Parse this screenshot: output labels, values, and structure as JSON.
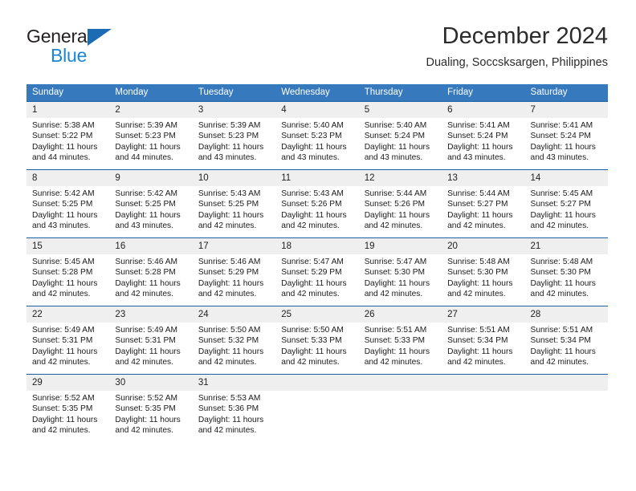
{
  "brand": {
    "name_part1": "General",
    "name_part2": "Blue",
    "triangle_color": "#1b6cb5",
    "blue_text_color": "#1b86d6"
  },
  "header": {
    "title": "December 2024",
    "subtitle": "Dualing, Soccsksargen, Philippines"
  },
  "theme": {
    "header_bg": "#3679bc",
    "row_border": "#1b5fa4",
    "daynum_bg": "#efefef"
  },
  "weekday_headers": [
    "Sunday",
    "Monday",
    "Tuesday",
    "Wednesday",
    "Thursday",
    "Friday",
    "Saturday"
  ],
  "labels": {
    "sunrise_prefix": "Sunrise:",
    "sunset_prefix": "Sunset:",
    "daylight_prefix": "Daylight:"
  },
  "weeks": [
    [
      {
        "day": "1",
        "sunrise": "Sunrise: 5:38 AM",
        "sunset": "Sunset: 5:22 PM",
        "daylight_line1": "Daylight: 11 hours",
        "daylight_line2": "and 44 minutes."
      },
      {
        "day": "2",
        "sunrise": "Sunrise: 5:39 AM",
        "sunset": "Sunset: 5:23 PM",
        "daylight_line1": "Daylight: 11 hours",
        "daylight_line2": "and 44 minutes."
      },
      {
        "day": "3",
        "sunrise": "Sunrise: 5:39 AM",
        "sunset": "Sunset: 5:23 PM",
        "daylight_line1": "Daylight: 11 hours",
        "daylight_line2": "and 43 minutes."
      },
      {
        "day": "4",
        "sunrise": "Sunrise: 5:40 AM",
        "sunset": "Sunset: 5:23 PM",
        "daylight_line1": "Daylight: 11 hours",
        "daylight_line2": "and 43 minutes."
      },
      {
        "day": "5",
        "sunrise": "Sunrise: 5:40 AM",
        "sunset": "Sunset: 5:24 PM",
        "daylight_line1": "Daylight: 11 hours",
        "daylight_line2": "and 43 minutes."
      },
      {
        "day": "6",
        "sunrise": "Sunrise: 5:41 AM",
        "sunset": "Sunset: 5:24 PM",
        "daylight_line1": "Daylight: 11 hours",
        "daylight_line2": "and 43 minutes."
      },
      {
        "day": "7",
        "sunrise": "Sunrise: 5:41 AM",
        "sunset": "Sunset: 5:24 PM",
        "daylight_line1": "Daylight: 11 hours",
        "daylight_line2": "and 43 minutes."
      }
    ],
    [
      {
        "day": "8",
        "sunrise": "Sunrise: 5:42 AM",
        "sunset": "Sunset: 5:25 PM",
        "daylight_line1": "Daylight: 11 hours",
        "daylight_line2": "and 43 minutes."
      },
      {
        "day": "9",
        "sunrise": "Sunrise: 5:42 AM",
        "sunset": "Sunset: 5:25 PM",
        "daylight_line1": "Daylight: 11 hours",
        "daylight_line2": "and 43 minutes."
      },
      {
        "day": "10",
        "sunrise": "Sunrise: 5:43 AM",
        "sunset": "Sunset: 5:25 PM",
        "daylight_line1": "Daylight: 11 hours",
        "daylight_line2": "and 42 minutes."
      },
      {
        "day": "11",
        "sunrise": "Sunrise: 5:43 AM",
        "sunset": "Sunset: 5:26 PM",
        "daylight_line1": "Daylight: 11 hours",
        "daylight_line2": "and 42 minutes."
      },
      {
        "day": "12",
        "sunrise": "Sunrise: 5:44 AM",
        "sunset": "Sunset: 5:26 PM",
        "daylight_line1": "Daylight: 11 hours",
        "daylight_line2": "and 42 minutes."
      },
      {
        "day": "13",
        "sunrise": "Sunrise: 5:44 AM",
        "sunset": "Sunset: 5:27 PM",
        "daylight_line1": "Daylight: 11 hours",
        "daylight_line2": "and 42 minutes."
      },
      {
        "day": "14",
        "sunrise": "Sunrise: 5:45 AM",
        "sunset": "Sunset: 5:27 PM",
        "daylight_line1": "Daylight: 11 hours",
        "daylight_line2": "and 42 minutes."
      }
    ],
    [
      {
        "day": "15",
        "sunrise": "Sunrise: 5:45 AM",
        "sunset": "Sunset: 5:28 PM",
        "daylight_line1": "Daylight: 11 hours",
        "daylight_line2": "and 42 minutes."
      },
      {
        "day": "16",
        "sunrise": "Sunrise: 5:46 AM",
        "sunset": "Sunset: 5:28 PM",
        "daylight_line1": "Daylight: 11 hours",
        "daylight_line2": "and 42 minutes."
      },
      {
        "day": "17",
        "sunrise": "Sunrise: 5:46 AM",
        "sunset": "Sunset: 5:29 PM",
        "daylight_line1": "Daylight: 11 hours",
        "daylight_line2": "and 42 minutes."
      },
      {
        "day": "18",
        "sunrise": "Sunrise: 5:47 AM",
        "sunset": "Sunset: 5:29 PM",
        "daylight_line1": "Daylight: 11 hours",
        "daylight_line2": "and 42 minutes."
      },
      {
        "day": "19",
        "sunrise": "Sunrise: 5:47 AM",
        "sunset": "Sunset: 5:30 PM",
        "daylight_line1": "Daylight: 11 hours",
        "daylight_line2": "and 42 minutes."
      },
      {
        "day": "20",
        "sunrise": "Sunrise: 5:48 AM",
        "sunset": "Sunset: 5:30 PM",
        "daylight_line1": "Daylight: 11 hours",
        "daylight_line2": "and 42 minutes."
      },
      {
        "day": "21",
        "sunrise": "Sunrise: 5:48 AM",
        "sunset": "Sunset: 5:30 PM",
        "daylight_line1": "Daylight: 11 hours",
        "daylight_line2": "and 42 minutes."
      }
    ],
    [
      {
        "day": "22",
        "sunrise": "Sunrise: 5:49 AM",
        "sunset": "Sunset: 5:31 PM",
        "daylight_line1": "Daylight: 11 hours",
        "daylight_line2": "and 42 minutes."
      },
      {
        "day": "23",
        "sunrise": "Sunrise: 5:49 AM",
        "sunset": "Sunset: 5:31 PM",
        "daylight_line1": "Daylight: 11 hours",
        "daylight_line2": "and 42 minutes."
      },
      {
        "day": "24",
        "sunrise": "Sunrise: 5:50 AM",
        "sunset": "Sunset: 5:32 PM",
        "daylight_line1": "Daylight: 11 hours",
        "daylight_line2": "and 42 minutes."
      },
      {
        "day": "25",
        "sunrise": "Sunrise: 5:50 AM",
        "sunset": "Sunset: 5:33 PM",
        "daylight_line1": "Daylight: 11 hours",
        "daylight_line2": "and 42 minutes."
      },
      {
        "day": "26",
        "sunrise": "Sunrise: 5:51 AM",
        "sunset": "Sunset: 5:33 PM",
        "daylight_line1": "Daylight: 11 hours",
        "daylight_line2": "and 42 minutes."
      },
      {
        "day": "27",
        "sunrise": "Sunrise: 5:51 AM",
        "sunset": "Sunset: 5:34 PM",
        "daylight_line1": "Daylight: 11 hours",
        "daylight_line2": "and 42 minutes."
      },
      {
        "day": "28",
        "sunrise": "Sunrise: 5:51 AM",
        "sunset": "Sunset: 5:34 PM",
        "daylight_line1": "Daylight: 11 hours",
        "daylight_line2": "and 42 minutes."
      }
    ],
    [
      {
        "day": "29",
        "sunrise": "Sunrise: 5:52 AM",
        "sunset": "Sunset: 5:35 PM",
        "daylight_line1": "Daylight: 11 hours",
        "daylight_line2": "and 42 minutes."
      },
      {
        "day": "30",
        "sunrise": "Sunrise: 5:52 AM",
        "sunset": "Sunset: 5:35 PM",
        "daylight_line1": "Daylight: 11 hours",
        "daylight_line2": "and 42 minutes."
      },
      {
        "day": "31",
        "sunrise": "Sunrise: 5:53 AM",
        "sunset": "Sunset: 5:36 PM",
        "daylight_line1": "Daylight: 11 hours",
        "daylight_line2": "and 42 minutes."
      },
      {
        "day": "",
        "sunrise": "",
        "sunset": "",
        "daylight_line1": "",
        "daylight_line2": ""
      },
      {
        "day": "",
        "sunrise": "",
        "sunset": "",
        "daylight_line1": "",
        "daylight_line2": ""
      },
      {
        "day": "",
        "sunrise": "",
        "sunset": "",
        "daylight_line1": "",
        "daylight_line2": ""
      },
      {
        "day": "",
        "sunrise": "",
        "sunset": "",
        "daylight_line1": "",
        "daylight_line2": ""
      }
    ]
  ]
}
